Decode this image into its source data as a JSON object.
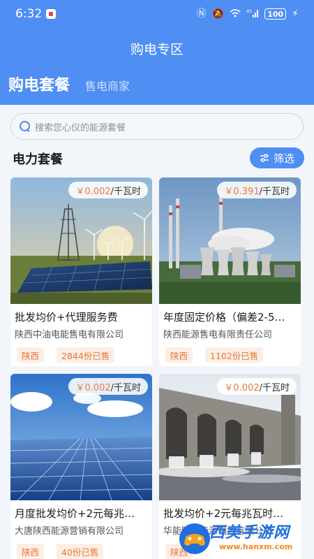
{
  "status_bar": {
    "time": "6:32",
    "network": "4G",
    "battery": "100"
  },
  "header": {
    "title": "购电专区"
  },
  "tabs": [
    {
      "label": "购电套餐",
      "active": true
    },
    {
      "label": "售电商家",
      "active": false
    }
  ],
  "search": {
    "placeholder": "搜索您心仪的能源套餐"
  },
  "section": {
    "title": "电力套餐",
    "filter_label": "筛选"
  },
  "cards": [
    {
      "price": "￥0.002",
      "unit": "/千瓦时",
      "title": "批发均价+代理服务费",
      "company": "陕西中油电能售电有限公司",
      "region": "陕西",
      "sold": "2844份已售",
      "image": "wind-solar-farm"
    },
    {
      "price": "￥0.391",
      "unit": "/千瓦时",
      "title": "年度固定价格（偏差2-5…",
      "company": "陕西能源售电有限责任公司",
      "region": "陕西",
      "sold": "1102份已售",
      "image": "power-plant"
    },
    {
      "price": "￥0.002",
      "unit": "/千瓦时",
      "title": "月度批发均价+2元每兆…",
      "company": "大唐陕西能源营销有限公司",
      "region": "陕西",
      "sold": "40份已售",
      "image": "solar-panels"
    },
    {
      "price": "￥0.002",
      "unit": "/千瓦时",
      "title": "批发均价+2元每兆瓦时…",
      "company": "华能陕西能源销售有限公司",
      "region": "陕西",
      "sold": "",
      "image": "hydro-dam"
    }
  ],
  "watermark": {
    "text": "西美手游网",
    "url": "www.hanxm.com"
  },
  "colors": {
    "primary": "#4f8ef2",
    "accent": "#ee7a3a",
    "tag_bg": "#fdeee4"
  }
}
